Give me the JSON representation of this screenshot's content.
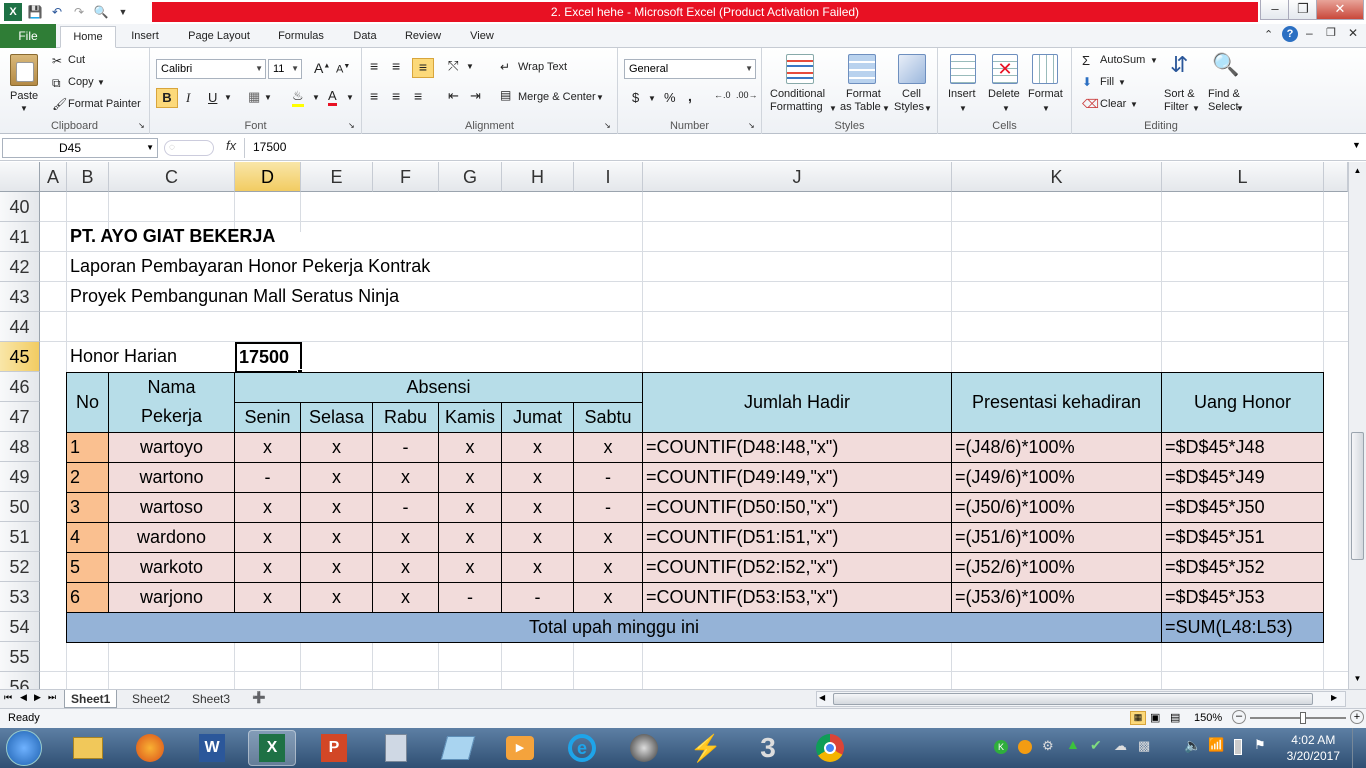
{
  "window": {
    "title": "2. Excel hehe  -  Microsoft Excel (Product Activation Failed)"
  },
  "tabs": [
    "File",
    "Home",
    "Insert",
    "Page Layout",
    "Formulas",
    "Data",
    "Review",
    "View"
  ],
  "ribbon": {
    "clipboard": {
      "paste": "Paste",
      "cut": "Cut",
      "copy": "Copy",
      "format_painter": "Format Painter",
      "label": "Clipboard"
    },
    "font": {
      "name": "Calibri",
      "size": "11",
      "label": "Font",
      "bold": "B",
      "italic": "I",
      "underline": "U"
    },
    "alignment": {
      "wrap": "Wrap Text",
      "merge": "Merge & Center",
      "label": "Alignment"
    },
    "number": {
      "format": "General",
      "currency": "$",
      "percent": "%",
      "comma": ",",
      "label": "Number"
    },
    "styles": {
      "conditional": "Conditional",
      "conditional2": "Formatting",
      "format_as": "Format",
      "format_as2": "as Table",
      "cell": "Cell",
      "cell2": "Styles",
      "label": "Styles"
    },
    "cells": {
      "insert": "Insert",
      "delete": "Delete",
      "format": "Format",
      "label": "Cells"
    },
    "editing": {
      "autosum": "AutoSum",
      "fill": "Fill",
      "clear": "Clear",
      "sort": "Sort &",
      "sort2": "Filter",
      "find": "Find &",
      "find2": "Select",
      "label": "Editing"
    }
  },
  "formula_bar": {
    "name_box": "D45",
    "fx": "fx",
    "content": "17500"
  },
  "columns": [
    "A",
    "B",
    "C",
    "D",
    "E",
    "F",
    "G",
    "H",
    "I",
    "J",
    "K",
    "L"
  ],
  "rows": [
    "40",
    "41",
    "42",
    "43",
    "44",
    "45",
    "46",
    "47",
    "48",
    "49",
    "50",
    "51",
    "52",
    "53",
    "54",
    "55",
    "56"
  ],
  "sheet": {
    "title1": "PT. AYO GIAT BEKERJA",
    "title2": "Laporan Pembayaran Honor Pekerja Kontrak",
    "title3": "Proyek Pembangunan Mall Seratus Ninja",
    "honor_label": "Honor Harian",
    "honor_value": "17500",
    "h_no": "No",
    "h_nama1": "Nama",
    "h_nama2": "Pekerja",
    "h_absensi": "Absensi",
    "days": [
      "Senin",
      "Selasa",
      "Rabu",
      "Kamis",
      "Jumat",
      "Sabtu"
    ],
    "h_jumlah": "Jumlah Hadir",
    "h_presentasi": "Presentasi kehadiran",
    "h_uang": "Uang Honor",
    "data": [
      {
        "no": "1",
        "nama": "wartoyo",
        "att": [
          "x",
          "x",
          "-",
          "x",
          "x",
          "x"
        ],
        "jumlah": "=COUNTIF(D48:I48,\"x\")",
        "pres": "=(J48/6)*100%",
        "uang": "=$D$45*J48"
      },
      {
        "no": "2",
        "nama": "wartono",
        "att": [
          "-",
          "x",
          "x",
          "x",
          "x",
          "-"
        ],
        "jumlah": "=COUNTIF(D49:I49,\"x\")",
        "pres": "=(J49/6)*100%",
        "uang": "=$D$45*J49"
      },
      {
        "no": "3",
        "nama": "wartoso",
        "att": [
          "x",
          "x",
          "-",
          "x",
          "x",
          "-"
        ],
        "jumlah": "=COUNTIF(D50:I50,\"x\")",
        "pres": "=(J50/6)*100%",
        "uang": "=$D$45*J50"
      },
      {
        "no": "4",
        "nama": "wardono",
        "att": [
          "x",
          "x",
          "x",
          "x",
          "x",
          "x"
        ],
        "jumlah": "=COUNTIF(D51:I51,\"x\")",
        "pres": "=(J51/6)*100%",
        "uang": "=$D$45*J51"
      },
      {
        "no": "5",
        "nama": "warkoto",
        "att": [
          "x",
          "x",
          "x",
          "x",
          "x",
          "x"
        ],
        "jumlah": "=COUNTIF(D52:I52,\"x\")",
        "pres": "=(J52/6)*100%",
        "uang": "=$D$45*J52"
      },
      {
        "no": "6",
        "nama": "warjono",
        "att": [
          "x",
          "x",
          "x",
          "-",
          "-",
          "x"
        ],
        "jumlah": "=COUNTIF(D53:I53,\"x\")",
        "pres": "=(J53/6)*100%",
        "uang": "=$D$45*J53"
      }
    ],
    "total_label": "Total upah minggu ini",
    "total_formula": "=SUM(L48:L53)"
  },
  "sheet_tabs": [
    "Sheet1",
    "Sheet2",
    "Sheet3"
  ],
  "status": {
    "ready": "Ready",
    "zoom": "150%"
  },
  "taskbar": {
    "time": "4:02 AM",
    "date": "3/20/2017"
  },
  "colors": {
    "header": "#b7dde8",
    "pink": "#f2dcdb",
    "orange": "#fac090",
    "total": "#95b3d7",
    "title_red": "#e81123",
    "file_green": "#2f7d36"
  }
}
